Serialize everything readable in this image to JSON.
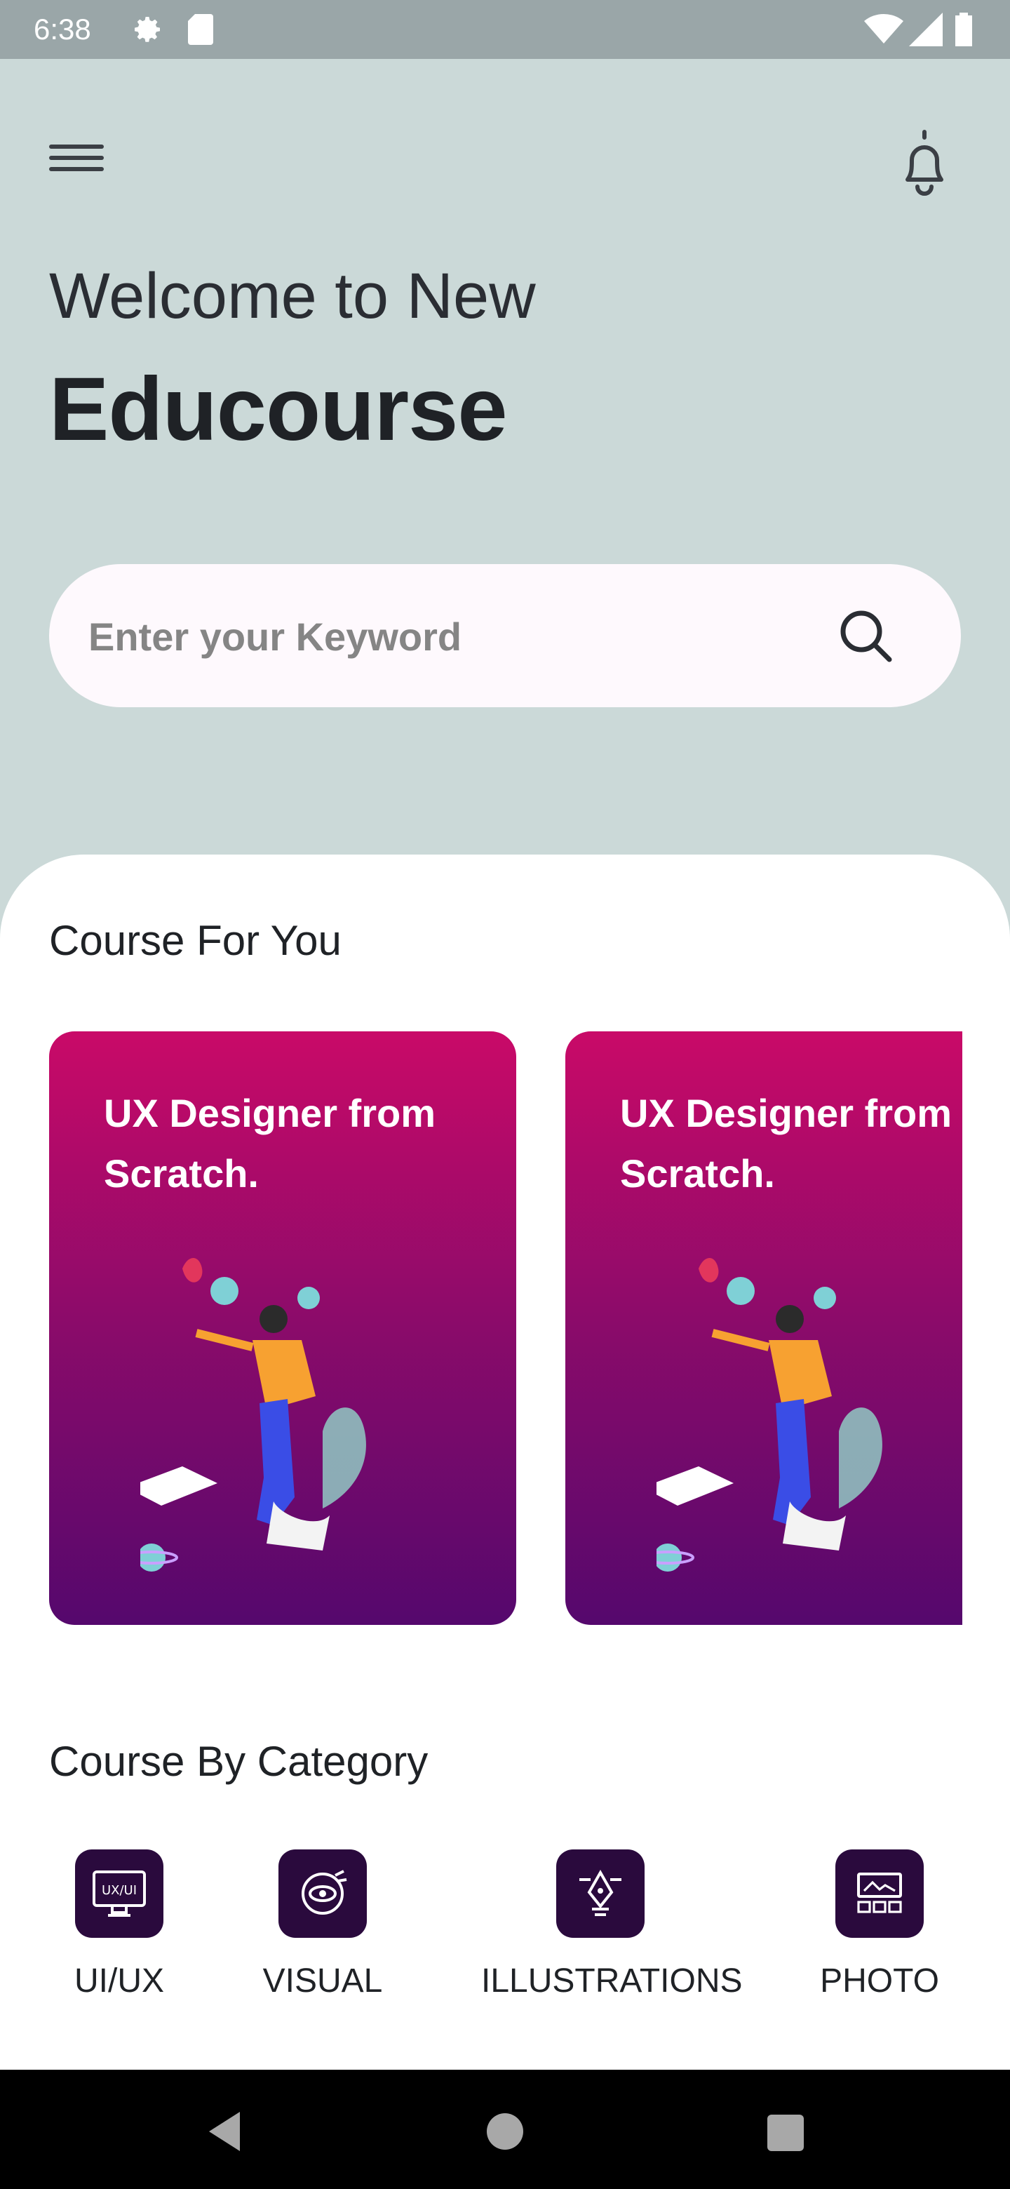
{
  "status_bar": {
    "time": "6:38",
    "icons": [
      "gear-icon",
      "sd-card-icon",
      "wifi-icon",
      "signal-icon",
      "battery-icon"
    ]
  },
  "header": {
    "welcome_line": "Welcome to New",
    "brand_name": "Educourse"
  },
  "search": {
    "placeholder": "Enter your Keyword",
    "value": ""
  },
  "courses": {
    "title": "Course For You",
    "items": [
      {
        "title": "UX Designer from Scratch."
      },
      {
        "title": "UX Designer from Scratch."
      }
    ]
  },
  "categories": {
    "title": "Course By Category",
    "items": [
      {
        "label": "UI/UX",
        "icon": "monitor-icon"
      },
      {
        "label": "VISUAL",
        "icon": "eye-target-icon"
      },
      {
        "label": "ILLUSTRATIONS",
        "icon": "pen-tool-icon"
      },
      {
        "label": "PHOTO",
        "icon": "gallery-icon"
      }
    ]
  },
  "colors": {
    "header_bg": "#cbd9d8",
    "card_gradient_top": "#c90a68",
    "card_gradient_bottom": "#55086d",
    "category_icon_bg": "#2a0a3d"
  }
}
